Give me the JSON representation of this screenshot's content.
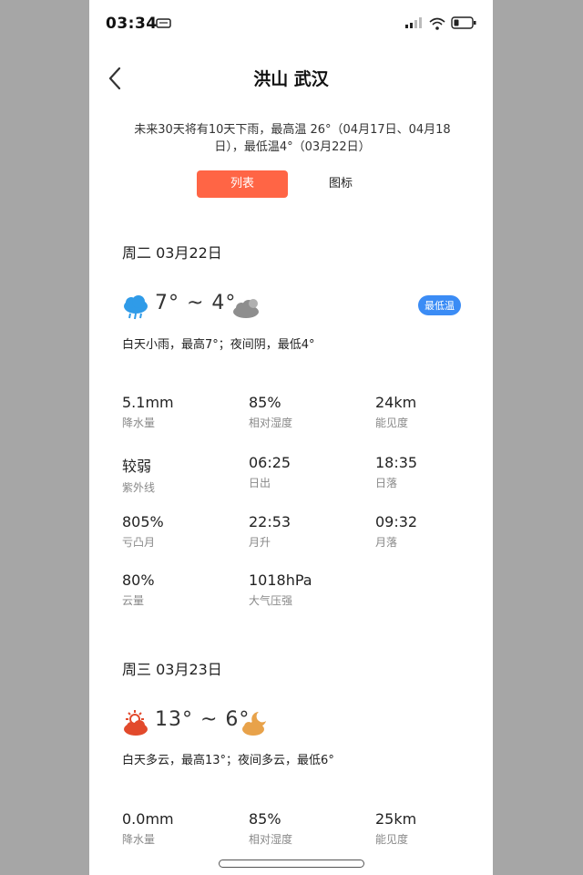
{
  "status": {
    "time": "03:34"
  },
  "header": {
    "title": "洪山  武汉"
  },
  "summary": "未来30天将有10天下雨，最高温 26°（04月17日、04月18日），最低温4°（03月22日）",
  "tabs": [
    {
      "label": "列表",
      "active": true
    },
    {
      "label": "图标",
      "active": false
    }
  ],
  "days": [
    {
      "date": "周二 03月22日",
      "day_icon": "rain-cloud-icon",
      "night_icon": "overcast-cloud-icon",
      "temp": "7° ~ 4°",
      "badge": "最低温",
      "desc": "白天小雨，最高7°；夜间阴，最低4°",
      "stats": [
        {
          "value": "5.1mm",
          "label": "降水量"
        },
        {
          "value": "85%",
          "label": "相对湿度"
        },
        {
          "value": "24km",
          "label": "能见度"
        },
        {
          "value": "较弱",
          "label": "紫外线"
        },
        {
          "value": "06:25",
          "label": "日出"
        },
        {
          "value": "18:35",
          "label": "日落"
        },
        {
          "value": "805%",
          "label": "亏凸月"
        },
        {
          "value": "22:53",
          "label": "月升"
        },
        {
          "value": "09:32",
          "label": "月落"
        },
        {
          "value": "80%",
          "label": "云量"
        },
        {
          "value": "1018hPa",
          "label": "大气压强"
        }
      ]
    },
    {
      "date": "周三 03月23日",
      "day_icon": "partly-cloudy-day-icon",
      "night_icon": "partly-cloudy-night-icon",
      "temp": "13° ~ 6°",
      "desc": "白天多云，最高13°；夜间多云，最低6°",
      "stats": [
        {
          "value": "0.0mm",
          "label": "降水量"
        },
        {
          "value": "85%",
          "label": "相对湿度"
        },
        {
          "value": "25km",
          "label": "能见度"
        }
      ]
    }
  ],
  "colors": {
    "accent": "#ff6545",
    "badge": "#3b8cf5",
    "rain": "#2f9be8",
    "cloud_gray": "#8e8e8e",
    "sun": "#e24a2c",
    "night": "#e8a24a"
  }
}
